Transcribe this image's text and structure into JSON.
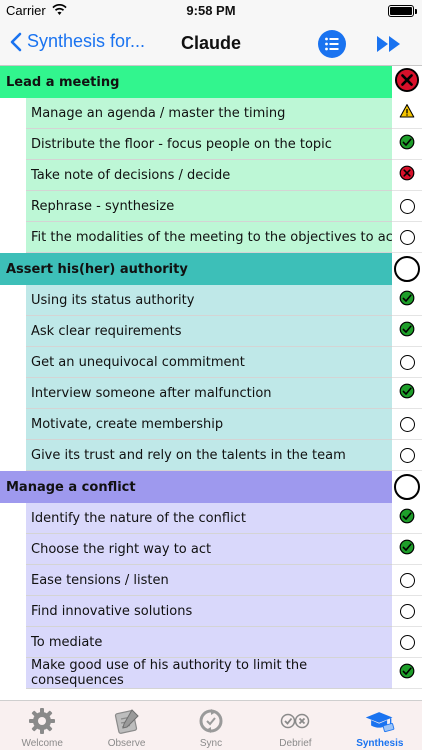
{
  "status_bar": {
    "carrier": "Carrier",
    "time": "9:58 PM"
  },
  "nav": {
    "back_label": "Synthesis for...",
    "title": "Claude"
  },
  "sections": [
    {
      "title": "Lead a meeting",
      "status": "fail",
      "items": [
        {
          "label": "Manage an agenda / master the timing",
          "status": "warning"
        },
        {
          "label": "Distribute the floor - focus people on the topic",
          "status": "ok"
        },
        {
          "label": "Take note of decisions / decide",
          "status": "fail"
        },
        {
          "label": "Rephrase - synthesize",
          "status": "empty"
        },
        {
          "label": "Fit the modalities of the meeting to the objectives to achieve (decision, information, innovatation, unity ...)",
          "status": "empty"
        }
      ]
    },
    {
      "title": "Assert his(her) authority",
      "status": "empty",
      "items": [
        {
          "label": "Using its status authority",
          "status": "ok"
        },
        {
          "label": "Ask clear requirements",
          "status": "ok"
        },
        {
          "label": "Get an unequivocal commitment",
          "status": "empty"
        },
        {
          "label": "Interview someone after malfunction",
          "status": "ok"
        },
        {
          "label": "Motivate, create membership",
          "status": "empty"
        },
        {
          "label": "Give its trust and rely on the talents in the team",
          "status": "empty"
        }
      ]
    },
    {
      "title": "Manage a conflict",
      "status": "empty",
      "items": [
        {
          "label": "Identify the nature of the conflict",
          "status": "ok"
        },
        {
          "label": "Choose the right way to act",
          "status": "ok"
        },
        {
          "label": "Ease tensions / listen",
          "status": "empty"
        },
        {
          "label": "Find innovative solutions",
          "status": "empty"
        },
        {
          "label": "To mediate",
          "status": "empty"
        },
        {
          "label": "Make good use of his authority to limit the consequences",
          "status": "ok"
        }
      ]
    }
  ],
  "tabs": [
    {
      "label": "Welcome",
      "icon": "gear-icon",
      "active": false
    },
    {
      "label": "Observe",
      "icon": "notepad-pen-icon",
      "active": false
    },
    {
      "label": "Sync",
      "icon": "sync-icon",
      "active": false
    },
    {
      "label": "Debrief",
      "icon": "check-cross-icon",
      "active": false
    },
    {
      "label": "Synthesis",
      "icon": "graduation-cap-icon",
      "active": true
    }
  ],
  "colors": {
    "accent": "#1a73f0",
    "section1_header": "#32f58e",
    "section1_row": "#bdf7d6",
    "section2_header": "#3dbfb8",
    "section2_row": "#bfe8e8",
    "section3_header": "#9e99ee",
    "section3_row": "#d9d8fb",
    "ok": "#1e9e2a",
    "fail": "#d8102a",
    "warning": "#f5c400"
  }
}
